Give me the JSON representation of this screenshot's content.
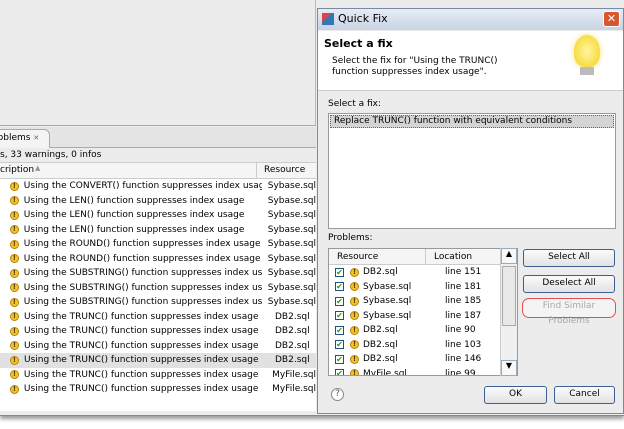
{
  "problems_view": {
    "tab_label": "Problems",
    "tab_close": "✕",
    "summary": "s, 33 warnings, 0 infos",
    "columns": {
      "description": "cription",
      "resource": "Resource"
    },
    "rows": [
      {
        "description": "Using the CONVERT() function suppresses index usage",
        "resource": "Sybase.sql"
      },
      {
        "description": "Using the LEN() function suppresses index usage",
        "resource": "Sybase.sql"
      },
      {
        "description": "Using the LEN() function suppresses index usage",
        "resource": "Sybase.sql"
      },
      {
        "description": "Using the LEN() function suppresses index usage",
        "resource": "Sybase.sql"
      },
      {
        "description": "Using the ROUND() function suppresses index usage",
        "resource": "Sybase.sql"
      },
      {
        "description": "Using the ROUND() function suppresses index usage",
        "resource": "Sybase.sql"
      },
      {
        "description": "Using the SUBSTRING() function suppresses index usage",
        "resource": "Sybase.sql"
      },
      {
        "description": "Using the SUBSTRING() function suppresses index usage",
        "resource": "Sybase.sql"
      },
      {
        "description": "Using the SUBSTRING() function suppresses index usage",
        "resource": "Sybase.sql"
      },
      {
        "description": "Using the TRUNC() function suppresses index usage",
        "resource": "DB2.sql"
      },
      {
        "description": "Using the TRUNC() function suppresses index usage",
        "resource": "DB2.sql"
      },
      {
        "description": "Using the TRUNC() function suppresses index usage",
        "resource": "DB2.sql"
      },
      {
        "description": "Using the TRUNC() function suppresses index usage",
        "resource": "DB2.sql",
        "selected": true
      },
      {
        "description": "Using the TRUNC() function suppresses index usage",
        "resource": "MyFile.sql"
      },
      {
        "description": "Using the TRUNC() function suppresses index usage",
        "resource": "MyFile.sql"
      }
    ]
  },
  "dialog": {
    "title": "Quick Fix",
    "heading": "Select a fix",
    "message": "Select the fix for \"Using the TRUNC() function suppresses index usage\".",
    "fix_label": "Select a fix:",
    "fixes": [
      "Replace TRUNC() function with equivalent conditions"
    ],
    "problems_label": "Problems:",
    "columns": {
      "resource": "Resource",
      "location": "Location"
    },
    "problems": [
      {
        "resource": "DB2.sql",
        "location": "line 151"
      },
      {
        "resource": "Sybase.sql",
        "location": "line 181"
      },
      {
        "resource": "Sybase.sql",
        "location": "line 185"
      },
      {
        "resource": "Sybase.sql",
        "location": "line 187"
      },
      {
        "resource": "DB2.sql",
        "location": "line 90"
      },
      {
        "resource": "DB2.sql",
        "location": "line 103"
      },
      {
        "resource": "DB2.sql",
        "location": "line 146"
      },
      {
        "resource": "MyFile.sql",
        "location": "line 99"
      }
    ],
    "buttons": {
      "select_all": "Select All",
      "deselect_all": "Deselect All",
      "find_similar": "Find Similar Problems",
      "ok": "OK",
      "cancel": "Cancel"
    },
    "help": "?",
    "accent": "#e05050"
  }
}
